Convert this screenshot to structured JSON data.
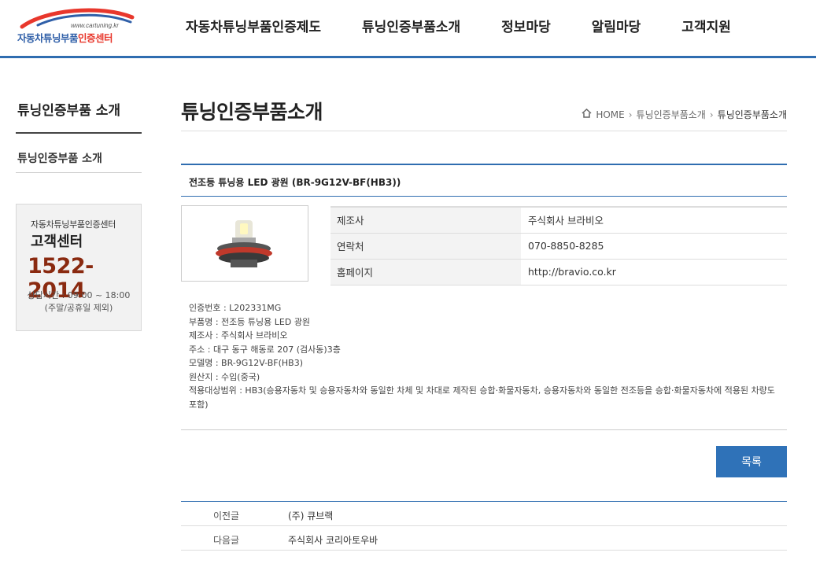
{
  "header": {
    "logo_url_text": "www.cartuning.kr",
    "logo_text_main": "자동차튜닝부품",
    "logo_text_accent": "인증센터",
    "nav": [
      "자동차튜닝부품인증제도",
      "튜닝인증부품소개",
      "정보마당",
      "알림마당",
      "고객지원"
    ]
  },
  "sidebar": {
    "title": "튜닝인증부품 소개",
    "items": [
      "튜닝인증부품 소개"
    ],
    "cs": {
      "org": "자동차튜닝부품인증센터",
      "label": "고객센터",
      "phone": "1522-2014",
      "hours": "상담시간 : 09:00 ~ 18:00",
      "note": "(주말/공휴일 제외)"
    }
  },
  "main": {
    "page_title": "튜닝인증부품소개",
    "breadcrumb": [
      "HOME",
      "튜닝인증부품소개",
      "튜닝인증부품소개"
    ],
    "product_name": "전조등 튜닝용 LED 광원 (BR-9G12V-BF(HB3))",
    "info": [
      {
        "key": "제조사",
        "value": "주식회사 브라비오"
      },
      {
        "key": "연락처",
        "value": "070-8850-8285"
      },
      {
        "key": "홈페이지",
        "value": "http://bravio.co.kr"
      }
    ],
    "spec_lines": [
      "인증번호 : L202331MG",
      "부품명 : 전조등 튜닝용 LED 광원",
      "제조사 : 주식회사 브라비오",
      "주소 : 대구 동구 해동로 207 (검사동)3층",
      "모델명 : BR-9G12V-BF(HB3)",
      "원산지 : 수입(중국)",
      "적용대상범위 : HB3(승용자동차 및 승용자동차와 동일한 차체 및 차대로 제작된 승합·화물자동차, 승용자동차와 동일한 전조등을 승합·화물자동차에 적용된 차량도 포함)"
    ],
    "list_button": "목록",
    "prev": {
      "label": "이전글",
      "title": "(주) 큐브랙"
    },
    "next": {
      "label": "다음글",
      "title": "주식회사 코리아토우바"
    }
  },
  "colors": {
    "accent": "#2f6db0",
    "phone": "#8a2a10"
  }
}
